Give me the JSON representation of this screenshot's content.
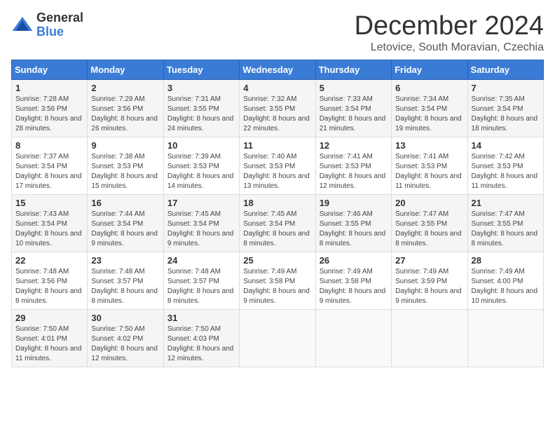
{
  "header": {
    "logo_general": "General",
    "logo_blue": "Blue",
    "title": "December 2024",
    "subtitle": "Letovice, South Moravian, Czechia"
  },
  "days_of_week": [
    "Sunday",
    "Monday",
    "Tuesday",
    "Wednesday",
    "Thursday",
    "Friday",
    "Saturday"
  ],
  "weeks": [
    [
      {
        "day": "1",
        "sunrise": "7:28 AM",
        "sunset": "3:56 PM",
        "daylight": "8 hours and 28 minutes."
      },
      {
        "day": "2",
        "sunrise": "7:29 AM",
        "sunset": "3:56 PM",
        "daylight": "8 hours and 26 minutes."
      },
      {
        "day": "3",
        "sunrise": "7:31 AM",
        "sunset": "3:55 PM",
        "daylight": "8 hours and 24 minutes."
      },
      {
        "day": "4",
        "sunrise": "7:32 AM",
        "sunset": "3:55 PM",
        "daylight": "8 hours and 22 minutes."
      },
      {
        "day": "5",
        "sunrise": "7:33 AM",
        "sunset": "3:54 PM",
        "daylight": "8 hours and 21 minutes."
      },
      {
        "day": "6",
        "sunrise": "7:34 AM",
        "sunset": "3:54 PM",
        "daylight": "8 hours and 19 minutes."
      },
      {
        "day": "7",
        "sunrise": "7:35 AM",
        "sunset": "3:54 PM",
        "daylight": "8 hours and 18 minutes."
      }
    ],
    [
      {
        "day": "8",
        "sunrise": "7:37 AM",
        "sunset": "3:54 PM",
        "daylight": "8 hours and 17 minutes."
      },
      {
        "day": "9",
        "sunrise": "7:38 AM",
        "sunset": "3:53 PM",
        "daylight": "8 hours and 15 minutes."
      },
      {
        "day": "10",
        "sunrise": "7:39 AM",
        "sunset": "3:53 PM",
        "daylight": "8 hours and 14 minutes."
      },
      {
        "day": "11",
        "sunrise": "7:40 AM",
        "sunset": "3:53 PM",
        "daylight": "8 hours and 13 minutes."
      },
      {
        "day": "12",
        "sunrise": "7:41 AM",
        "sunset": "3:53 PM",
        "daylight": "8 hours and 12 minutes."
      },
      {
        "day": "13",
        "sunrise": "7:41 AM",
        "sunset": "3:53 PM",
        "daylight": "8 hours and 11 minutes."
      },
      {
        "day": "14",
        "sunrise": "7:42 AM",
        "sunset": "3:53 PM",
        "daylight": "8 hours and 11 minutes."
      }
    ],
    [
      {
        "day": "15",
        "sunrise": "7:43 AM",
        "sunset": "3:54 PM",
        "daylight": "8 hours and 10 minutes."
      },
      {
        "day": "16",
        "sunrise": "7:44 AM",
        "sunset": "3:54 PM",
        "daylight": "8 hours and 9 minutes."
      },
      {
        "day": "17",
        "sunrise": "7:45 AM",
        "sunset": "3:54 PM",
        "daylight": "8 hours and 9 minutes."
      },
      {
        "day": "18",
        "sunrise": "7:45 AM",
        "sunset": "3:54 PM",
        "daylight": "8 hours and 8 minutes."
      },
      {
        "day": "19",
        "sunrise": "7:46 AM",
        "sunset": "3:55 PM",
        "daylight": "8 hours and 8 minutes."
      },
      {
        "day": "20",
        "sunrise": "7:47 AM",
        "sunset": "3:55 PM",
        "daylight": "8 hours and 8 minutes."
      },
      {
        "day": "21",
        "sunrise": "7:47 AM",
        "sunset": "3:55 PM",
        "daylight": "8 hours and 8 minutes."
      }
    ],
    [
      {
        "day": "22",
        "sunrise": "7:48 AM",
        "sunset": "3:56 PM",
        "daylight": "8 hours and 8 minutes."
      },
      {
        "day": "23",
        "sunrise": "7:48 AM",
        "sunset": "3:57 PM",
        "daylight": "8 hours and 8 minutes."
      },
      {
        "day": "24",
        "sunrise": "7:48 AM",
        "sunset": "3:57 PM",
        "daylight": "8 hours and 8 minutes."
      },
      {
        "day": "25",
        "sunrise": "7:49 AM",
        "sunset": "3:58 PM",
        "daylight": "8 hours and 9 minutes."
      },
      {
        "day": "26",
        "sunrise": "7:49 AM",
        "sunset": "3:58 PM",
        "daylight": "8 hours and 9 minutes."
      },
      {
        "day": "27",
        "sunrise": "7:49 AM",
        "sunset": "3:59 PM",
        "daylight": "8 hours and 9 minutes."
      },
      {
        "day": "28",
        "sunrise": "7:49 AM",
        "sunset": "4:00 PM",
        "daylight": "8 hours and 10 minutes."
      }
    ],
    [
      {
        "day": "29",
        "sunrise": "7:50 AM",
        "sunset": "4:01 PM",
        "daylight": "8 hours and 11 minutes."
      },
      {
        "day": "30",
        "sunrise": "7:50 AM",
        "sunset": "4:02 PM",
        "daylight": "8 hours and 12 minutes."
      },
      {
        "day": "31",
        "sunrise": "7:50 AM",
        "sunset": "4:03 PM",
        "daylight": "8 hours and 12 minutes."
      },
      null,
      null,
      null,
      null
    ]
  ],
  "labels": {
    "sunrise": "Sunrise:",
    "sunset": "Sunset:",
    "daylight": "Daylight:"
  }
}
